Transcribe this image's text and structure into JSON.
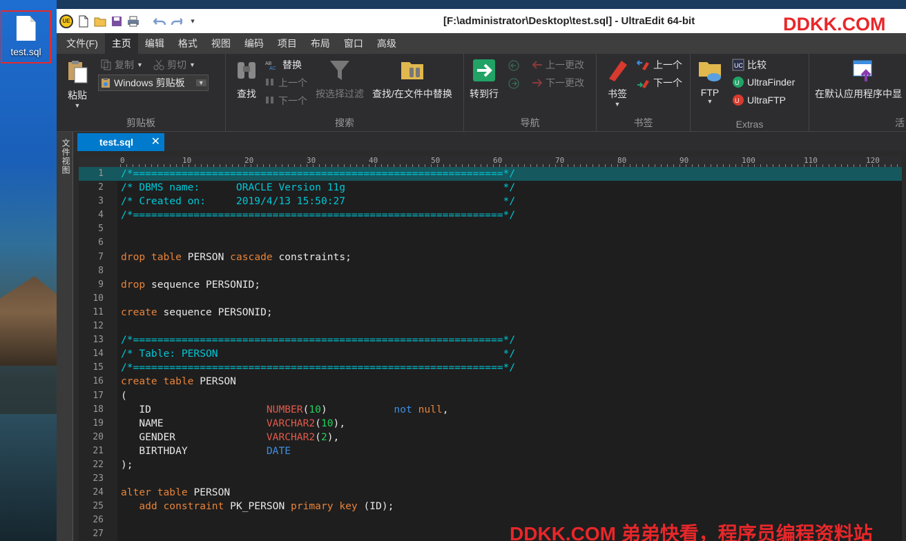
{
  "desktop": {
    "icon_label": "test.sql"
  },
  "window": {
    "title": "[F:\\administrator\\Desktop\\test.sql] - UltraEdit 64-bit",
    "qa_dropdown": "▾"
  },
  "watermark_top": "DDKK.COM",
  "watermark_bottom": "DDKK.COM 弟弟快看，程序员编程资料站",
  "menu": [
    "文件(F)",
    "主页",
    "编辑",
    "格式",
    "视图",
    "编码",
    "项目",
    "布局",
    "窗口",
    "高级"
  ],
  "ribbon": {
    "clipboard": {
      "label": "剪贴板",
      "paste": "粘贴",
      "copy": "复制",
      "cut": "剪切",
      "windows_clipboard": "Windows 剪贴板"
    },
    "search": {
      "label": "搜索",
      "find": "查找",
      "replace": "替换",
      "prev": "上一个",
      "next": "下一个",
      "filter": "按选择过滤",
      "find_in_files": "查找/在文件中替换"
    },
    "nav": {
      "label": "导航",
      "goto": "转到行",
      "prev_change": "上一更改",
      "next_change": "下一更改"
    },
    "bookmarks": {
      "label": "书签",
      "bookmark": "书签",
      "prev": "上一个",
      "next": "下一个"
    },
    "extras": {
      "label": "Extras",
      "ftp": "FTP",
      "compare": "比较",
      "finder": "UltraFinder",
      "uftp": "UltraFTP"
    },
    "last": {
      "open_default": "在默认应用程序中显",
      "label_partial": "活"
    }
  },
  "side_panel": {
    "label": "文件视图"
  },
  "tab": {
    "name": "test.sql",
    "close": "✕"
  },
  "ruler_ticks": [
    "0",
    "10",
    "20",
    "30",
    "40",
    "50",
    "60",
    "70",
    "80",
    "90",
    "100",
    "110",
    "120"
  ],
  "code_lines": [
    [
      [
        "c",
        "/*=============================================================*/"
      ]
    ],
    [
      [
        "c",
        "/* DBMS name:      ORACLE Version 11g                          */"
      ]
    ],
    [
      [
        "c",
        "/* Created on:     2019/4/13 15:50:27                          */"
      ]
    ],
    [
      [
        "c",
        "/*=============================================================*/"
      ]
    ],
    [],
    [],
    [
      [
        "k",
        "drop table"
      ],
      [
        "p",
        " PERSON "
      ],
      [
        "k",
        "cascade"
      ],
      [
        "p",
        " constraints;"
      ]
    ],
    [],
    [
      [
        "k",
        "drop"
      ],
      [
        "p",
        " sequence PERSONID;"
      ]
    ],
    [],
    [
      [
        "k",
        "create"
      ],
      [
        "p",
        " sequence PERSONID;"
      ]
    ],
    [],
    [
      [
        "c",
        "/*=============================================================*/"
      ]
    ],
    [
      [
        "c",
        "/* Table: PERSON                                               */"
      ]
    ],
    [
      [
        "c",
        "/*=============================================================*/"
      ]
    ],
    [
      [
        "k",
        "create table"
      ],
      [
        "p",
        " PERSON"
      ]
    ],
    [
      [
        "p",
        "("
      ]
    ],
    [
      [
        "p",
        "   ID                   "
      ],
      [
        "t",
        "NUMBER"
      ],
      [
        "p",
        "("
      ],
      [
        "n",
        "10"
      ],
      [
        "p",
        ")           "
      ],
      [
        "b",
        "not"
      ],
      [
        "p",
        " "
      ],
      [
        "k",
        "null"
      ],
      [
        "p",
        ","
      ]
    ],
    [
      [
        "p",
        "   NAME                 "
      ],
      [
        "t",
        "VARCHAR2"
      ],
      [
        "p",
        "("
      ],
      [
        "n",
        "10"
      ],
      [
        "p",
        "),"
      ]
    ],
    [
      [
        "p",
        "   GENDER               "
      ],
      [
        "t",
        "VARCHAR2"
      ],
      [
        "p",
        "("
      ],
      [
        "n",
        "2"
      ],
      [
        "p",
        "),"
      ]
    ],
    [
      [
        "p",
        "   BIRTHDAY             "
      ],
      [
        "b",
        "DATE"
      ]
    ],
    [
      [
        "p",
        ");"
      ]
    ],
    [],
    [
      [
        "k",
        "alter table"
      ],
      [
        "p",
        " PERSON"
      ]
    ],
    [
      [
        "p",
        "   "
      ],
      [
        "k",
        "add constraint"
      ],
      [
        "p",
        " PK_PERSON "
      ],
      [
        "k",
        "primary key"
      ],
      [
        "p",
        " (ID);"
      ]
    ],
    [],
    []
  ]
}
